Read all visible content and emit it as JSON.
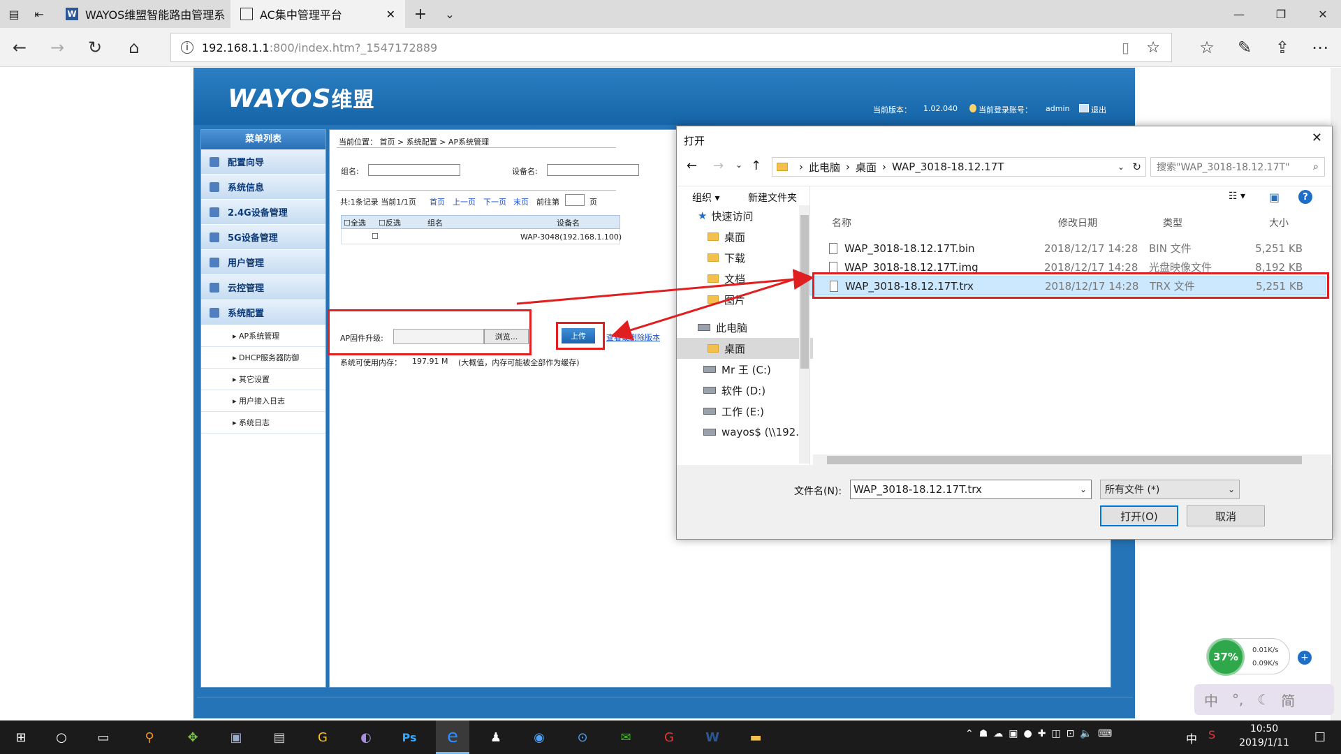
{
  "browser": {
    "tabs": [
      {
        "label": "WAYOS维盟智能路由管理系"
      },
      {
        "label": "AC集中管理平台"
      }
    ],
    "new_tab": "+",
    "tab_menu": "⌄",
    "url_host": "192.168.1.1",
    "url_rest": ":800/index.htm?_1547172889"
  },
  "router": {
    "logo_en": "WAYOS",
    "logo_cn": "维盟",
    "version_label": "当前版本：",
    "version": "1.02.040",
    "account_label": "当前登录账号：",
    "account": "admin",
    "logout": "退出",
    "menu_title": "菜单列表",
    "menu": [
      {
        "label": "配置向导"
      },
      {
        "label": "系统信息"
      },
      {
        "label": "2.4G设备管理"
      },
      {
        "label": "5G设备管理"
      },
      {
        "label": "用户管理"
      },
      {
        "label": "云控管理"
      },
      {
        "label": "系统配置"
      }
    ],
    "submenu": [
      {
        "label": "AP系统管理"
      },
      {
        "label": "DHCP服务器防御"
      },
      {
        "label": "其它设置"
      },
      {
        "label": "用户接入日志"
      },
      {
        "label": "系统日志"
      }
    ],
    "breadcrumb": "当前位置： 首页 > 系统配置 > AP系统管理",
    "group_label": "组名:",
    "device_label": "设备名:",
    "pager_text": "共:1条记录 当前1/1页",
    "pager_first": "首页",
    "pager_prev": "上一页",
    "pager_next": "下一页",
    "pager_last": "末页",
    "pager_goto": "前往第",
    "pager_page": "页",
    "table_headers": {
      "select_all": "全选",
      "invert": "反选",
      "group": "组名",
      "device": "设备名"
    },
    "table_rows": [
      {
        "device": "WAP-3048(192.168.1.100)"
      }
    ],
    "upgrade_label": "AP固件升级:",
    "browse": "浏览...",
    "upload": "上传",
    "view_link": "查看或删除版本",
    "mem_label": "系统可使用内存：",
    "mem_value": "197.91 M",
    "mem_note": "(大概值，内存可能被全部作为缓存)"
  },
  "dialog": {
    "title": "打开",
    "path": [
      "此电脑",
      "桌面",
      "WAP_3018-18.12.17T"
    ],
    "search_placeholder": "搜索\"WAP_3018-18.12.17T\"",
    "organize": "组织",
    "new_folder": "新建文件夹",
    "tree": [
      {
        "label": "快速访问"
      },
      {
        "label": "桌面"
      },
      {
        "label": "下载"
      },
      {
        "label": "文档"
      },
      {
        "label": "图片"
      },
      {
        "label": "此电脑"
      },
      {
        "label": "桌面"
      },
      {
        "label": "Mr 王 (C:)"
      },
      {
        "label": "软件 (D:)"
      },
      {
        "label": "工作 (E:)"
      },
      {
        "label": "wayos$ (\\\\192.1"
      }
    ],
    "columns": {
      "name": "名称",
      "date": "修改日期",
      "type": "类型",
      "size": "大小"
    },
    "files": [
      {
        "name": "WAP_3018-18.12.17T.bin",
        "date": "2018/12/17 14:28",
        "type": "BIN 文件",
        "size": "5,251 KB"
      },
      {
        "name": "WAP_3018-18.12.17T.img",
        "date": "2018/12/17 14:28",
        "type": "光盘映像文件",
        "size": "8,192 KB"
      },
      {
        "name": "WAP_3018-18.12.17T.trx",
        "date": "2018/12/17 14:28",
        "type": "TRX 文件",
        "size": "5,251 KB"
      }
    ],
    "filename_label": "文件名(N):",
    "filename": "WAP_3018-18.12.17T.trx",
    "filter": "所有文件 (*)",
    "open": "打开(O)",
    "cancel": "取消"
  },
  "widget": {
    "percent": "37%",
    "up": "0.01K/s",
    "down": "0.09K/s",
    "ime": "中",
    "ime2": "简"
  },
  "taskbar": {
    "time": "10:50",
    "date": "2019/1/11",
    "ime": "中"
  },
  "colors": {
    "accent_blue": "#2574b8",
    "red_highlight": "#e02020",
    "selection": "#cce8ff"
  }
}
